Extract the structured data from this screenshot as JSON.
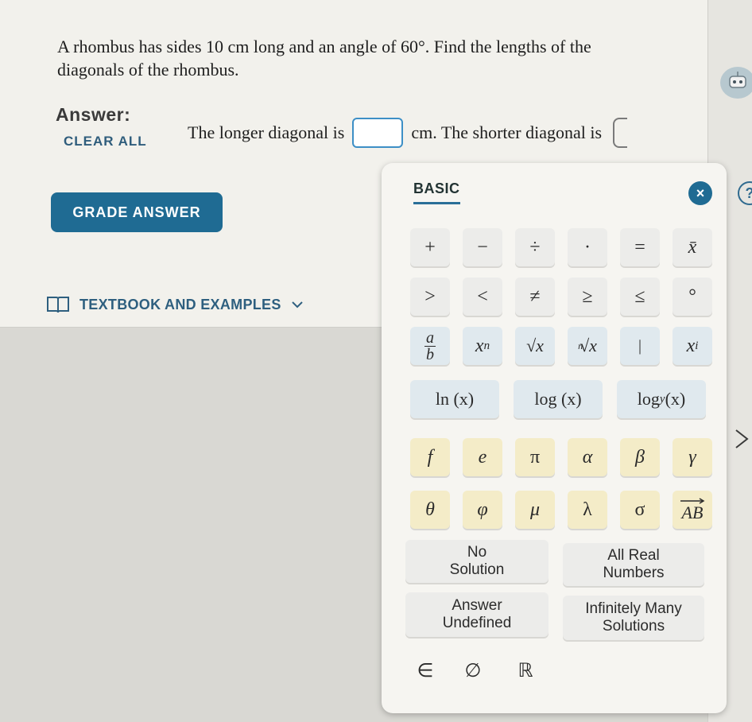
{
  "question": {
    "text": "A rhombus has sides 10 cm long and an angle of 60°. Find the lengths of the diagonals of the rhombus."
  },
  "answer": {
    "label": "Answer:",
    "clear_all": "CLEAR ALL",
    "sentence_part1": "The longer diagonal is",
    "sentence_part2": "cm. The shorter diagonal is"
  },
  "grade_button": "GRADE ANSWER",
  "textbook_link": "TEXTBOOK AND EXAMPLES",
  "help_label": "?",
  "keypad": {
    "tab": "BASIC",
    "close": "×",
    "row1": [
      "+",
      "−",
      "÷",
      "·",
      "=",
      "x̄"
    ],
    "row2": [
      ">",
      "<",
      "≠",
      "≥",
      "≤",
      "°"
    ],
    "row3": {
      "frac_num": "a",
      "frac_den": "b",
      "power_base": "x",
      "power_exp": "n",
      "sqrt": "√x",
      "nroot_index": "n",
      "nroot": "√x",
      "bar": "|",
      "sub_base": "x",
      "sub_index": "i"
    },
    "row4": [
      "ln (x)",
      "log (x)",
      "log",
      "y",
      "(x)"
    ],
    "row5": [
      "f",
      "e",
      "π",
      "α",
      "β",
      "γ"
    ],
    "row6": [
      "θ",
      "φ",
      "μ",
      "λ",
      "σ",
      "AB"
    ],
    "special": {
      "no_solution": "No\nSolution",
      "all_real": "All Real\nNumbers",
      "undefined": "Answer\nUndefined",
      "infinite": "Infinitely Many\nSolutions"
    },
    "row_sets": [
      "∈",
      "∅",
      "ℝ"
    ]
  },
  "colors": {
    "primary_button": "#1f6b93",
    "input_border": "#3d8fc6",
    "key_gray": "#ececea",
    "key_blue": "#e0e9ee",
    "key_yellow": "#f4ecc8"
  }
}
